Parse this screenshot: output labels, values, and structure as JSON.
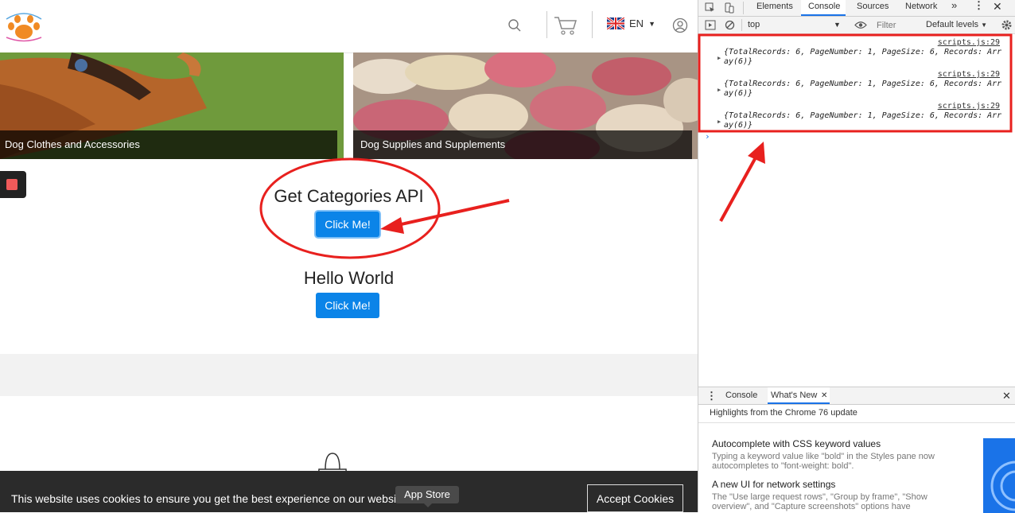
{
  "site": {
    "header": {
      "language": "EN"
    },
    "tiles": [
      {
        "caption": "Dog Clothes and Accessories"
      },
      {
        "caption": "Dog Supplies and Supplements"
      }
    ],
    "blocks": [
      {
        "title": "Get Categories API",
        "button": "Click Me!"
      },
      {
        "title": "Hello World",
        "button": "Click Me!"
      }
    ],
    "tooltip": "App Store",
    "cookie": {
      "text": "This website uses cookies to ensure you get the best experience on our website. Lea",
      "accept": "Accept Cookies"
    }
  },
  "devtools": {
    "tabs": [
      "Elements",
      "Console",
      "Sources",
      "Network"
    ],
    "active_tab": "Console",
    "toolbar": {
      "context": "top",
      "filter_placeholder": "Filter",
      "levels": "Default levels"
    },
    "logs": [
      {
        "source": "scripts.js:29",
        "text": "{TotalRecords: 6, PageNumber: 1, PageSize: 6, Records: Array(6)}"
      },
      {
        "source": "scripts.js:29",
        "text": "{TotalRecords: 6, PageNumber: 1, PageSize: 6, Records: Array(6)}"
      },
      {
        "source": "scripts.js:29",
        "text": "{TotalRecords: 6, PageNumber: 1, PageSize: 6, Records: Array(6)}"
      }
    ],
    "drawer": {
      "tabs": [
        "Console",
        "What's New"
      ],
      "active_tab": "What's New",
      "highlights": "Highlights from the Chrome 76 update",
      "features": [
        {
          "title": "Autocomplete with CSS keyword values",
          "desc": "Typing a keyword value like \"bold\" in the Styles pane now autocompletes to \"font-weight: bold\"."
        },
        {
          "title": "A new UI for network settings",
          "desc": "The \"Use large request rows\", \"Group by frame\", \"Show overview\", and \"Capture screenshots\" options have"
        }
      ]
    }
  },
  "colors": {
    "button_blue": "#0b84e8",
    "annotation_red": "#e8201e",
    "cookie_bar": "#2b2b2b"
  }
}
